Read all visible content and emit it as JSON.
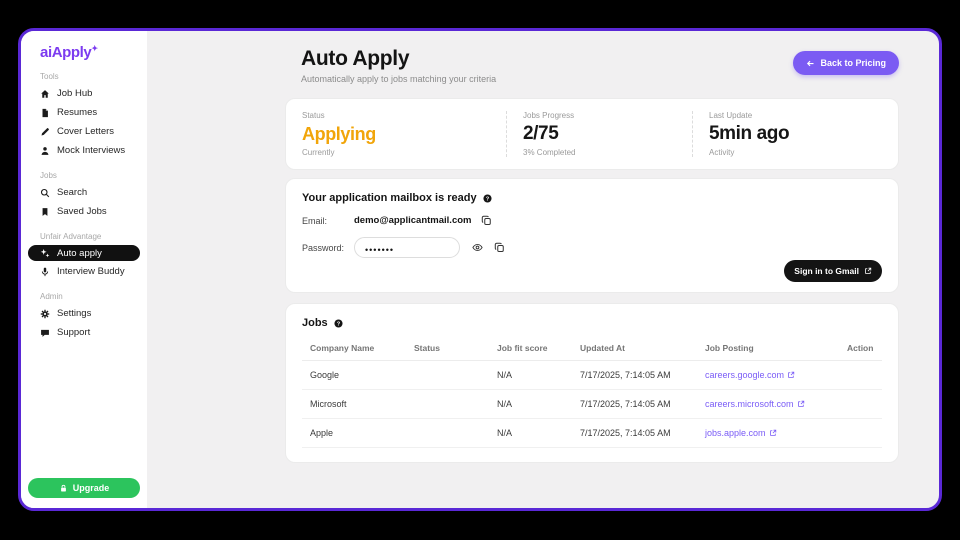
{
  "app": {
    "logo": "aiApply",
    "logo_mark": "✦"
  },
  "colors": {
    "window_border": "#5a28d6",
    "brand_purple": "#7c3bf0",
    "accent_button": "#7b5bf3",
    "status_amber": "#f1a50a",
    "upgrade_green": "#2cc45d",
    "link_purple": "#7a5cf6",
    "active_item_bg": "#111111",
    "main_bg": "#f1f0f1"
  },
  "sidebar": {
    "sections": [
      {
        "label": "Tools",
        "items": [
          {
            "label": "Job Hub",
            "icon": "home"
          },
          {
            "label": "Resumes",
            "icon": "document"
          },
          {
            "label": "Cover Letters",
            "icon": "pen"
          },
          {
            "label": "Mock Interviews",
            "icon": "person"
          }
        ]
      },
      {
        "label": "Jobs",
        "items": [
          {
            "label": "Search",
            "icon": "search"
          },
          {
            "label": "Saved Jobs",
            "icon": "bookmark"
          }
        ]
      },
      {
        "label": "Unfair Advantage",
        "items": [
          {
            "label": "Auto apply",
            "icon": "sparkles",
            "active": true
          },
          {
            "label": "Interview Buddy",
            "icon": "microphone"
          }
        ]
      },
      {
        "label": "Admin",
        "items": [
          {
            "label": "Settings",
            "icon": "gear"
          },
          {
            "label": "Support",
            "icon": "chat"
          }
        ]
      }
    ],
    "upgrade_label": "Upgrade"
  },
  "header": {
    "title": "Auto Apply",
    "subtitle": "Automatically apply to jobs matching your criteria",
    "back_button": "Back to Pricing"
  },
  "status_card": {
    "columns": [
      {
        "top": "Status",
        "value": "Applying",
        "bottom": "Currently"
      },
      {
        "top": "Jobs Progress",
        "value": "2/75",
        "bottom": "3% Completed"
      },
      {
        "top": "Last Update",
        "value": "5min ago",
        "bottom": "Activity"
      }
    ]
  },
  "mailbox_card": {
    "title": "Your application mailbox is ready",
    "email_label": "Email:",
    "email_value": "demo@applicantmail.com",
    "password_label": "Password:",
    "password_value": "•••••••",
    "gmail_button": "Sign in to Gmail"
  },
  "jobs_card": {
    "title": "Jobs",
    "columns": [
      "Company Name",
      "Status",
      "Job fit score",
      "Updated At",
      "Job Posting",
      "Action"
    ],
    "rows": [
      {
        "company": "Google",
        "status": "",
        "job_fit_score": "N/A",
        "updated_at": "7/17/2025, 7:14:05 AM",
        "job_posting": "careers.google.com",
        "action": ""
      },
      {
        "company": "Microsoft",
        "status": "",
        "job_fit_score": "N/A",
        "updated_at": "7/17/2025, 7:14:05 AM",
        "job_posting": "careers.microsoft.com",
        "action": ""
      },
      {
        "company": "Apple",
        "status": "",
        "job_fit_score": "N/A",
        "updated_at": "7/17/2025, 7:14:05 AM",
        "job_posting": "jobs.apple.com",
        "action": ""
      }
    ]
  }
}
